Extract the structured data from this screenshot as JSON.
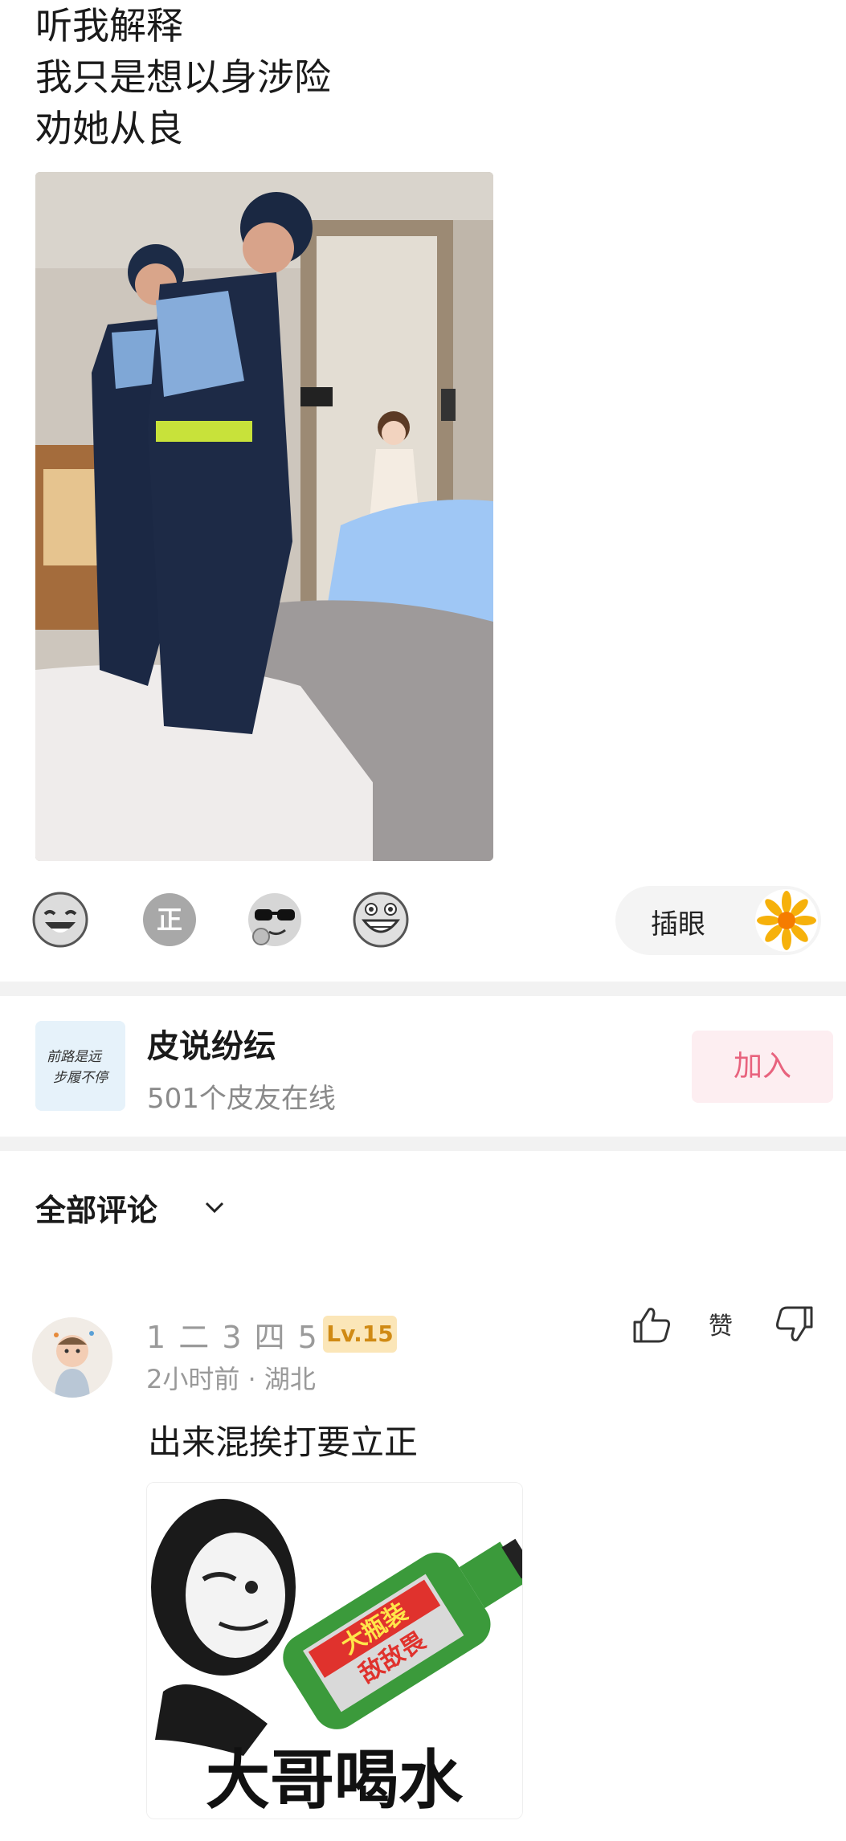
{
  "post": {
    "lines": [
      "听我解释",
      "我只是想以身涉险",
      "劝她从良"
    ],
    "image_alt": "police officers in hotel room photo"
  },
  "reactions": [
    "laughing-emoji",
    "zheng-emoji",
    "sunglasses-emoji",
    "grinning-emoji"
  ],
  "chayan": {
    "label": "插眼",
    "icon": "sunflower-icon"
  },
  "group": {
    "name": "皮说纷纭",
    "online": "501个皮友在线",
    "join_label": "加入",
    "avatar_text_line1": "前路是远",
    "avatar_text_line2": "步履不停"
  },
  "comments_section": {
    "heading": "全部评论"
  },
  "comment": {
    "username": "1 二 3 四 5",
    "level": "Lv.15",
    "time": "2小时前",
    "location": "湖北",
    "separator": " · ",
    "text": "出来混挨打要立正",
    "like_label": "赞",
    "sticker_caption": "大哥喝水",
    "bottle_label_1": "大瓶装",
    "bottle_label_2": "敌敌畏"
  },
  "colors": {
    "accent_pink": "#e8637e",
    "join_bg": "#fdeef1",
    "level_bg": "#fbe6b8",
    "level_text": "#d08a14",
    "divider": "#f2f2f2"
  }
}
